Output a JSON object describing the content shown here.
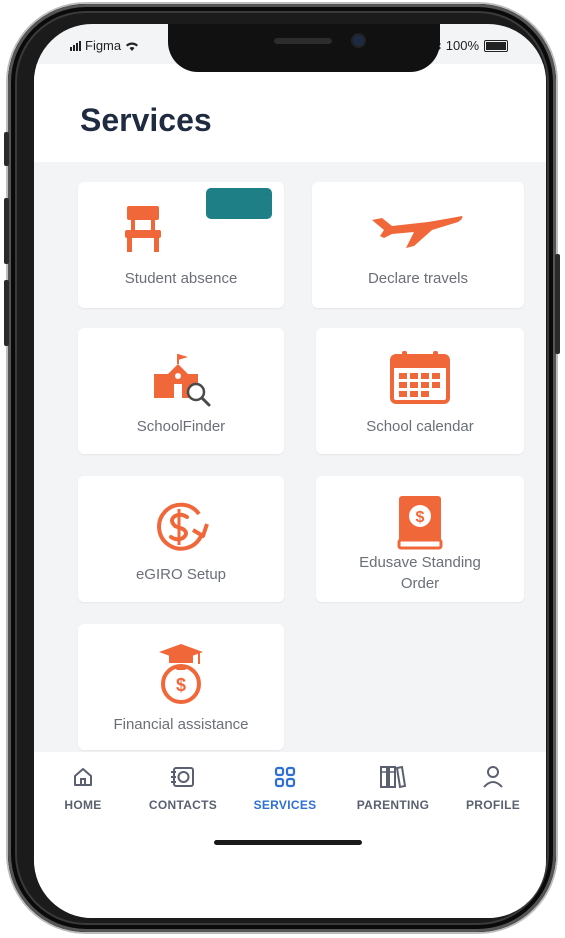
{
  "status_bar": {
    "carrier": "Figma",
    "battery_text": "100%"
  },
  "header": {
    "title": "Services"
  },
  "tiles": [
    {
      "label": "Student absence",
      "icon": "chair-icon"
    },
    {
      "label": "Declare travels",
      "icon": "airplane-icon"
    },
    {
      "label": "SchoolFinder",
      "icon": "school-search-icon"
    },
    {
      "label": "School calendar",
      "icon": "calendar-icon"
    },
    {
      "label": "eGIRO Setup",
      "icon": "dollar-refresh-icon"
    },
    {
      "label": "Edusave Standing Order",
      "label_line1": "Edusave Standing",
      "label_line2": "Order",
      "icon": "dollar-book-icon"
    },
    {
      "label": "Financial assistance",
      "icon": "graduation-money-icon"
    }
  ],
  "tabbar": {
    "items": [
      {
        "label": "HOME",
        "icon": "home-icon"
      },
      {
        "label": "CONTACTS",
        "icon": "contacts-icon"
      },
      {
        "label": "SERVICES",
        "icon": "grid-icon",
        "active": true
      },
      {
        "label": "PARENTING",
        "icon": "books-icon"
      },
      {
        "label": "PROFILE",
        "icon": "person-icon"
      }
    ]
  },
  "colors": {
    "accent_orange": "#f0683a",
    "active_tab": "#2f6fd6",
    "title": "#1f2b40",
    "tooltip_chip": "#1e7f86"
  }
}
